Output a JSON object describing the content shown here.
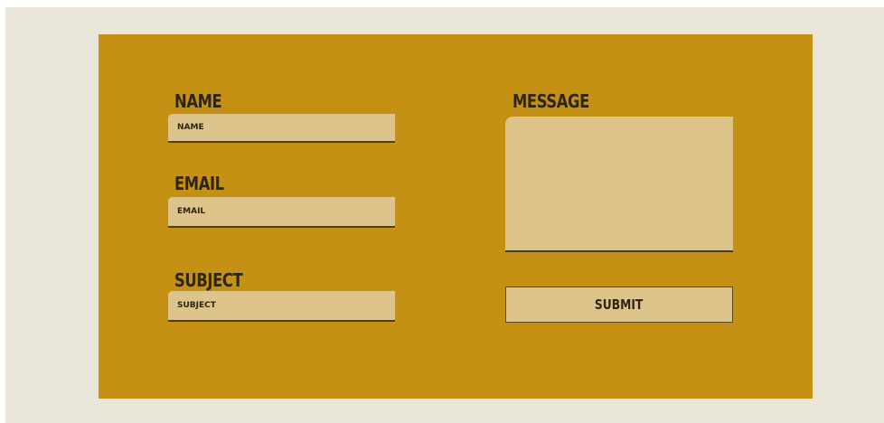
{
  "contact_form": {
    "name": {
      "label": "NAME",
      "placeholder": "NAME",
      "value": ""
    },
    "email": {
      "label": "EMAIL",
      "placeholder": "EMAIL",
      "value": ""
    },
    "subject": {
      "label": "SUBJECT",
      "placeholder": "SUBJECT",
      "value": ""
    },
    "message": {
      "label": "MESSAGE",
      "value": ""
    },
    "submit_label": "SUBMIT"
  },
  "colors": {
    "page_background": "#ebe6da",
    "panel": "#c49114",
    "field": "#dcc48a",
    "text": "#2e2510"
  }
}
